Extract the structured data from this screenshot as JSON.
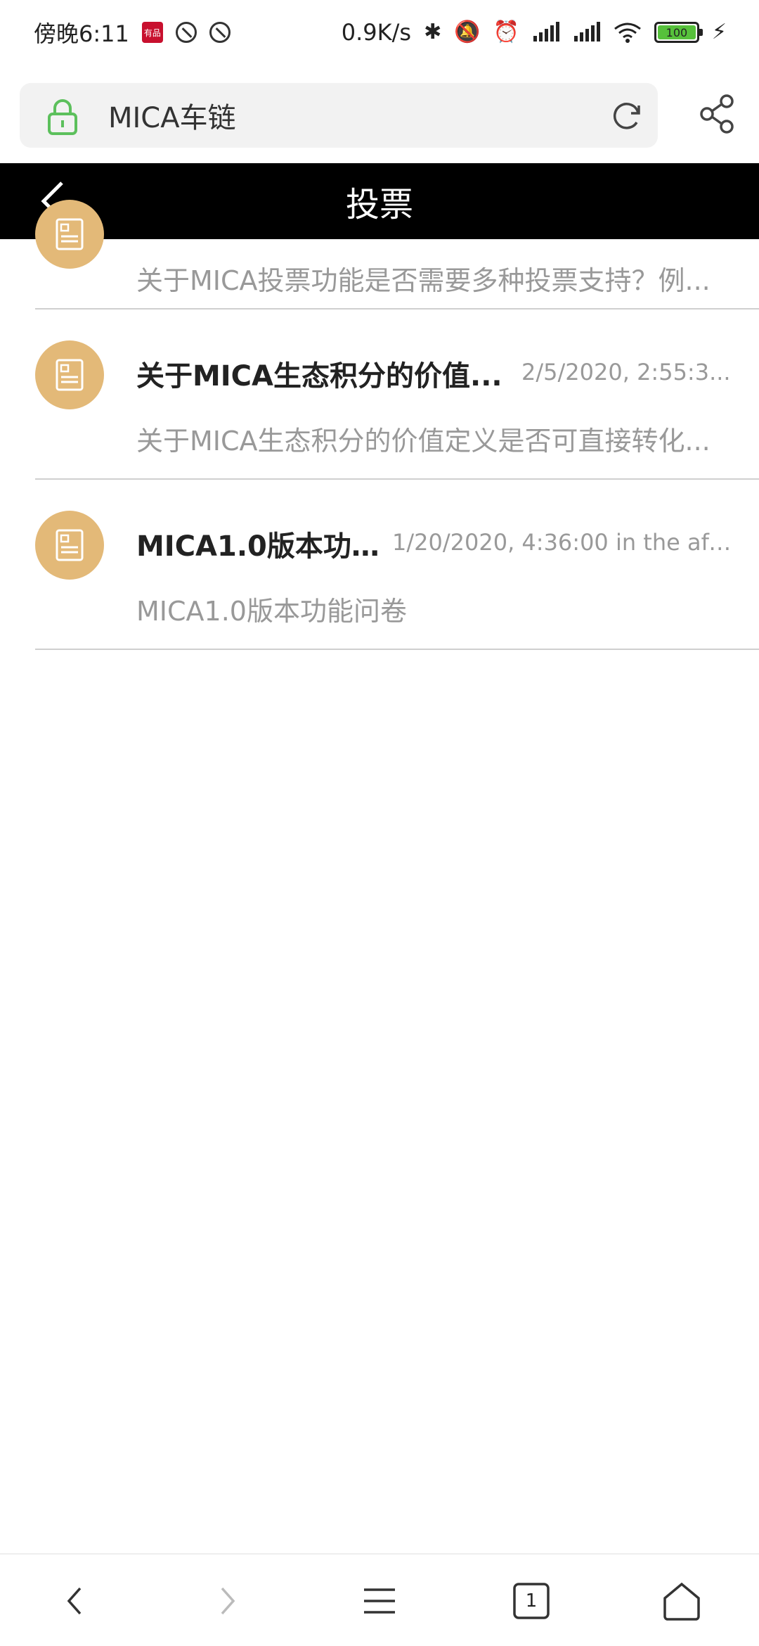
{
  "status": {
    "time": "傍晚6:11",
    "badge": "有品",
    "net_speed": "0.9K/s",
    "battery": "100"
  },
  "browser": {
    "url_title": "MICA车链",
    "tab_count": "1"
  },
  "header": {
    "title": "投票"
  },
  "votes": [
    {
      "title": "",
      "time": "",
      "desc": "关于MICA投票功能是否需要多种投票支持？例..."
    },
    {
      "title": "关于MICA生态积分的价值...",
      "time": "2/5/2020, 2:55:3...",
      "desc": "关于MICA生态积分的价值定义是否可直接转化..."
    },
    {
      "title": "MICA1.0版本功能..",
      "time": "1/20/2020, 4:36:00 in the aft...",
      "desc": "MICA1.0版本功能问卷"
    }
  ],
  "colors": {
    "header_bg": "#000000",
    "avatar": "#e3b978",
    "lock": "#5cc05c"
  }
}
